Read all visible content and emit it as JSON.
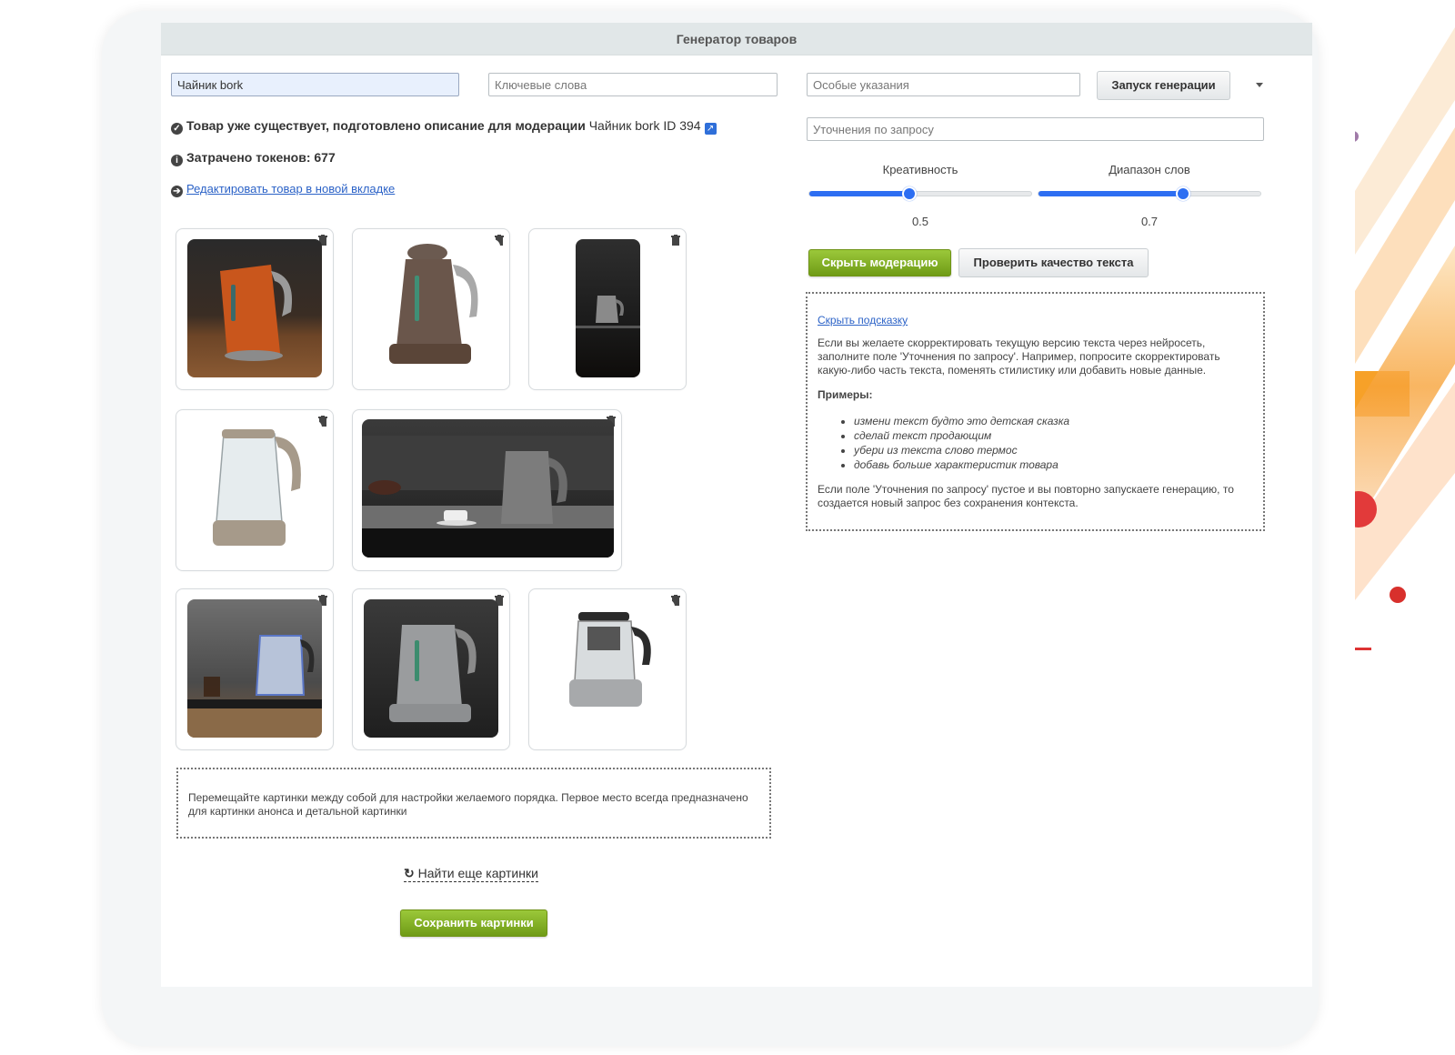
{
  "header": {
    "title": "Генератор товаров"
  },
  "inputs": {
    "product_value": "Чайник bork",
    "keywords_placeholder": "Ключевые слова",
    "special_placeholder": "Особые указания",
    "refine_placeholder": "Уточнения по запросу"
  },
  "buttons": {
    "generate": "Запуск генерации",
    "hide_moderation": "Скрыть модерацию",
    "check_quality": "Проверить качество текста",
    "find_more": "Найти еще картинки",
    "save_images": "Сохранить картинки"
  },
  "status": {
    "exists_label": "Товар уже существует, подготовлено описание для модерации",
    "exists_product": "Чайник bork ID 394",
    "tokens": "Затрачено токенов: 677",
    "edit_link": "Редактировать товар в новой вкладке"
  },
  "sliders": [
    {
      "label": "Креативность",
      "value_text": "0.5",
      "value": 0.5
    },
    {
      "label": "Диапазон слов",
      "value_text": "0.7",
      "value": 0.7
    }
  ],
  "hint": {
    "hide_link": "Скрыть подсказку",
    "intro": "Если вы желаете скорректировать текущую версию текста через нейросеть, заполните поле 'Уточнения по запросу'. Например, попросите скорректировать какую-либо часть текста, поменять стилистику или добавить новые данные.",
    "examples_title": "Примеры:",
    "examples": [
      "измени текст будто это детская сказка",
      "сделай текст продающим",
      "убери из текста слово термос",
      "добавь больше характеристик товара"
    ],
    "outro": "Если поле 'Уточнения по запросу' пустое и вы повторно запускаете генерацию, то создается новый запрос без сохранения контекста."
  },
  "images_note": "Перемещайте картинки между собой для настройки желаемого порядка. Первое место всегда предназначено для картинки анонса и детальной картинки",
  "images": [
    {
      "name": "kettle-orange"
    },
    {
      "name": "kettle-bronze"
    },
    {
      "name": "kettle-dark-scene"
    },
    {
      "name": "kettle-glass-beige"
    },
    {
      "name": "kettle-kitchen-wide"
    },
    {
      "name": "kettle-glass-blue"
    },
    {
      "name": "kettle-steel-dark"
    },
    {
      "name": "kettle-tea-maker"
    }
  ],
  "colors": {
    "accent_green": "#7fae22",
    "slider_blue": "#2d6ef2",
    "link_blue": "#2b62c7"
  }
}
